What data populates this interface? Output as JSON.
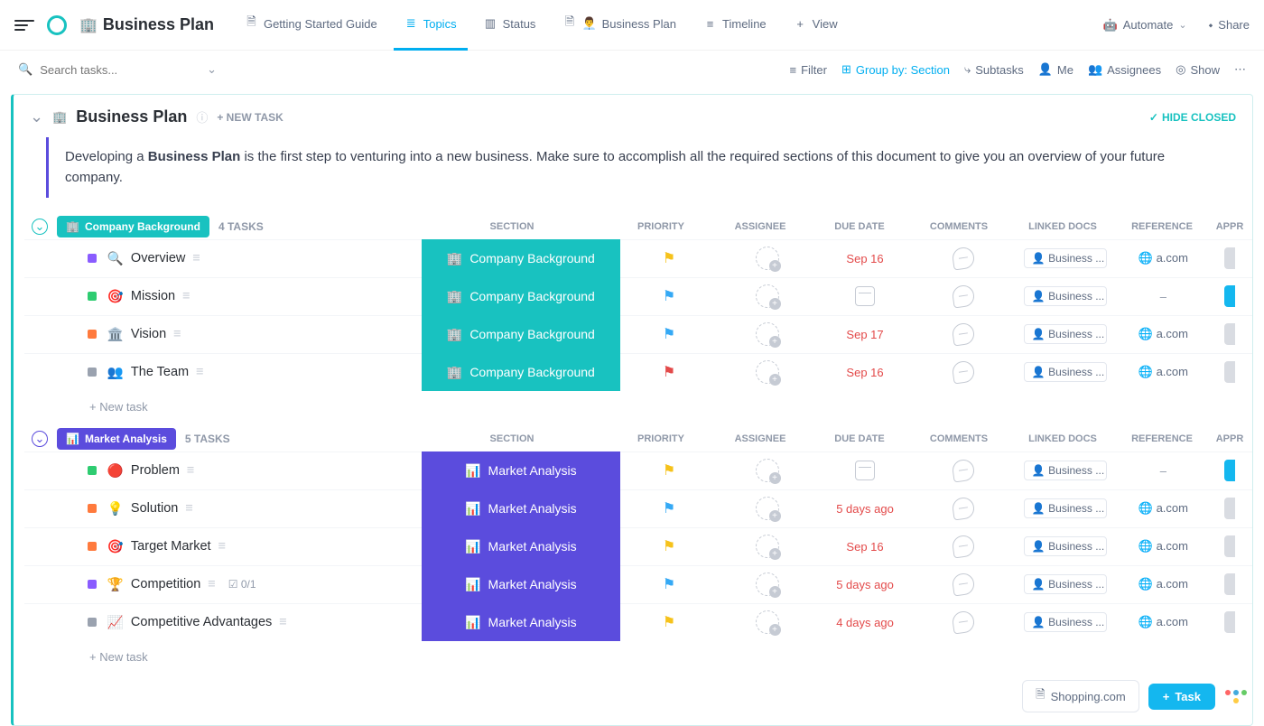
{
  "header": {
    "title": "Business Plan",
    "title_emoji": "🏢",
    "tabs": [
      {
        "label": "Getting Started Guide",
        "icon": "doc"
      },
      {
        "label": "Topics",
        "icon": "list",
        "active": true
      },
      {
        "label": "Status",
        "icon": "board"
      },
      {
        "label": "Business Plan",
        "icon": "doc",
        "emoji": "👨‍💼"
      },
      {
        "label": "Timeline",
        "icon": "timeline"
      },
      {
        "label": "View",
        "icon": "plus"
      }
    ],
    "automate": "Automate",
    "share": "Share"
  },
  "search": {
    "placeholder": "Search tasks..."
  },
  "toolbar": {
    "filter": "Filter",
    "group": "Group by: Section",
    "subtasks": "Subtasks",
    "me": "Me",
    "assignees": "Assignees",
    "show": "Show"
  },
  "board": {
    "title": "Business Plan",
    "title_emoji": "🏢",
    "new_task": "+ NEW TASK",
    "hide_closed": "HIDE CLOSED",
    "description": {
      "pre": "Developing a ",
      "bold": "Business Plan",
      "post": " is the first step to venturing into a new business. Make sure to accomplish all the required sections of this document to give you an overview of your future company."
    }
  },
  "columns": {
    "section": "SECTION",
    "priority": "PRIORITY",
    "assignee": "ASSIGNEE",
    "due": "DUE DATE",
    "comments": "COMMENTS",
    "linked": "LINKED DOCS",
    "reference": "REFERENCE",
    "approve": "APPR"
  },
  "row_labels": {
    "new_task": "+ New task",
    "subtask_count": "0/1"
  },
  "groups": [
    {
      "name": "Company Background",
      "emoji": "🏢",
      "color": "#18c2c0",
      "count_label": "4 TASKS",
      "section_label": "Company Background",
      "tasks": [
        {
          "emoji": "🔍",
          "name": "Overview",
          "status": "#8a5cff",
          "flag": "#f6c21b",
          "due": "Sep 16",
          "doc": "Business ...",
          "ref": "a.com",
          "approve": "#d9dce2"
        },
        {
          "emoji": "🎯",
          "name": "Mission",
          "status": "#2ecc71",
          "flag": "#35a9f5",
          "due": "",
          "doc": "Business ...",
          "ref": "-",
          "approve": "#14b7ef"
        },
        {
          "emoji": "🏛️",
          "name": "Vision",
          "status": "#ff7a3d",
          "flag": "#35a9f5",
          "due": "Sep 17",
          "doc": "Business ...",
          "ref": "a.com",
          "approve": "#d9dce2"
        },
        {
          "emoji": "👥",
          "name": "The Team",
          "status": "#9aa2af",
          "flag": "#e34a4a",
          "due": "Sep 16",
          "doc": "Business ...",
          "ref": "a.com",
          "approve": "#d9dce2"
        }
      ]
    },
    {
      "name": "Market Analysis",
      "emoji": "📊",
      "color": "#5b4cdd",
      "count_label": "5 TASKS",
      "section_label": "Market Analysis",
      "tasks": [
        {
          "emoji": "🔴",
          "name": "Problem",
          "status": "#2ecc71",
          "flag": "#f6c21b",
          "due": "",
          "doc": "Business ...",
          "ref": "-",
          "approve": "#14b7ef"
        },
        {
          "emoji": "💡",
          "name": "Solution",
          "status": "#ff7a3d",
          "flag": "#35a9f5",
          "due": "5 days ago",
          "doc": "Business ...",
          "ref": "a.com",
          "approve": "#d9dce2"
        },
        {
          "emoji": "🎯",
          "name": "Target Market",
          "status": "#ff7a3d",
          "flag": "#f6c21b",
          "due": "Sep 16",
          "doc": "Business ...",
          "ref": "a.com",
          "approve": "#d9dce2"
        },
        {
          "emoji": "🏆",
          "name": "Competition",
          "status": "#8a5cff",
          "flag": "#35a9f5",
          "due": "5 days ago",
          "doc": "Business ...",
          "ref": "a.com",
          "approve": "#d9dce2",
          "subtasks": "0/1"
        },
        {
          "emoji": "📈",
          "name": "Competitive Advantages",
          "status": "#9aa2af",
          "flag": "#f6c21b",
          "due": "4 days ago",
          "doc": "Business ...",
          "ref": "a.com",
          "approve": "#d9dce2"
        }
      ]
    }
  ],
  "float": {
    "tag": "Shopping.com",
    "task": "Task"
  }
}
